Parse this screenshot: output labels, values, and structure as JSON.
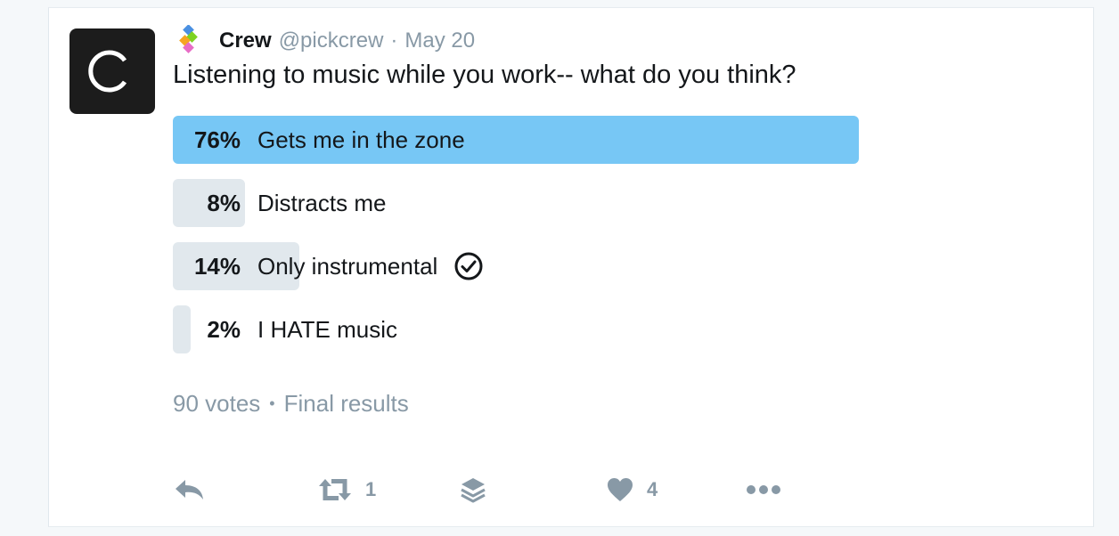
{
  "tweet": {
    "name": "Crew",
    "handle": "@pickcrew",
    "separator": "·",
    "date": "May 20",
    "text": "Listening to music while you work-- what do you think?"
  },
  "poll": {
    "options": [
      {
        "percent_label": "76%",
        "percent": 76,
        "label": "Gets me in the zone",
        "leading": true,
        "selected": false
      },
      {
        "percent_label": "8%",
        "percent": 8,
        "label": "Distracts me",
        "leading": false,
        "selected": false
      },
      {
        "percent_label": "14%",
        "percent": 14,
        "label": "Only instrumental",
        "leading": false,
        "selected": true
      },
      {
        "percent_label": "2%",
        "percent": 2,
        "label": "I HATE music",
        "leading": false,
        "selected": false
      }
    ],
    "votes": "90 votes",
    "bullet": "•",
    "status": "Final results"
  },
  "actions": {
    "retweet_count": "1",
    "like_count": "4"
  },
  "icons": {
    "avatar": "crew-c-logo-icon",
    "brand": "crew-diamond-logo-icon",
    "selected": "check-circle-icon",
    "reply": "reply-icon",
    "retweet": "retweet-icon",
    "stack": "layers-icon",
    "like": "heart-icon",
    "more": "more-dots-icon"
  },
  "colors": {
    "leading_bar": "#77c7f5",
    "bar": "#e1e8ed",
    "muted": "#8899a6",
    "text": "#14171a"
  }
}
